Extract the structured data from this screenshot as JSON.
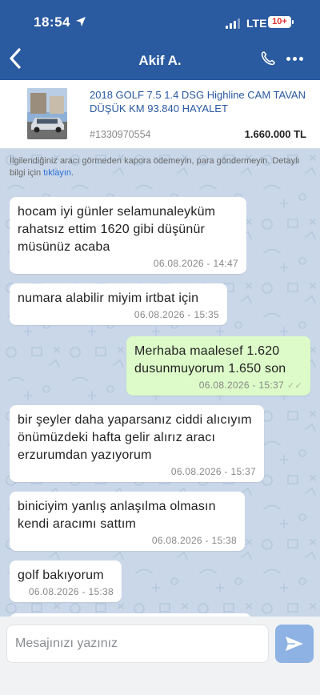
{
  "status_bar": {
    "time": "18:54",
    "network": "LTE",
    "battery": "10+"
  },
  "header": {
    "contact_name": "Akif A.",
    "back_icon": "chevron-left-icon",
    "phone_icon": "phone-icon",
    "more_icon": "more-horizontal-icon"
  },
  "listing": {
    "title": "2018 GOLF 7.5 1.4 DSG Highline CAM TAVAN DÜŞÜK KM 93.840 HAYALET",
    "id": "#1330970554",
    "price": "1.660.000 TL"
  },
  "notice": {
    "text": "İlgilendiğiniz aracı görmeden kapora ödemeyin, para göndermeyin. Detaylı bilgi için ",
    "link_text": "tıklayın",
    "end": "."
  },
  "messages": [
    {
      "direction": "in",
      "text": "hocam iyi günler selamunaleyküm rahatsız ettim 1620 gibi düşünür müsünüz acaba",
      "time": "06.08.2026 - 14:47"
    },
    {
      "direction": "in",
      "text": "numara alabilir miyim irtbat için",
      "time": "06.08.2026 - 15:35"
    },
    {
      "direction": "out",
      "text": "Merhaba maalesef 1.620 dusunmuyorum 1.650 son",
      "time": "06.08.2026 - 15:37"
    },
    {
      "direction": "in",
      "text": "bir şeyler daha yaparsanız ciddi alıcıyım önümüzdeki hafta gelir alırız aracı erzurumdan yazıyorum",
      "time": "06.08.2026 - 15:37"
    },
    {
      "direction": "in",
      "text": "biniciyim yanlış anlaşılma olmasın kendi aracımı sattım",
      "time": "06.08.2026 - 15:38"
    },
    {
      "direction": "in",
      "text": "golf bakıyorum",
      "time": "06.08.2026 - 15:38"
    }
  ],
  "composer": {
    "placeholder": "Mesajınızı yazınız",
    "value": "",
    "send_icon": "send-icon"
  },
  "colors": {
    "header_bg": "#2a5aa0",
    "chat_bg": "#c9d7e8",
    "outgoing_bubble": "#dcfbc8",
    "incoming_bubble": "#ffffff",
    "link": "#2a6fd6"
  }
}
